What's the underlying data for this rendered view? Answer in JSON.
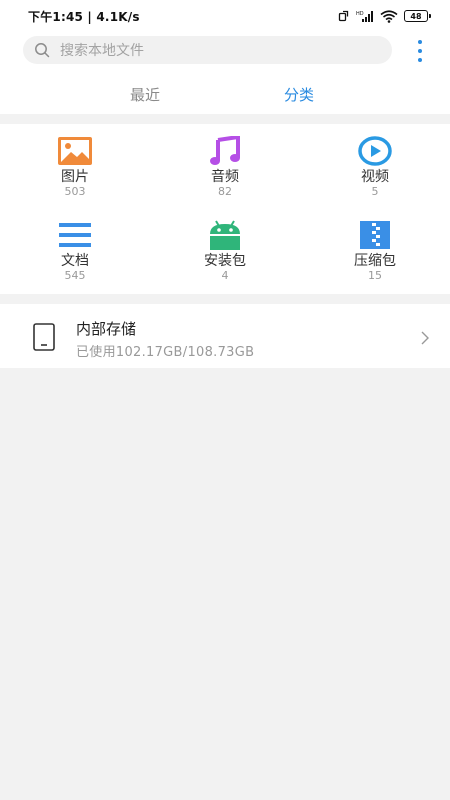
{
  "status_bar": {
    "time_speed": "下午1:45 | 4.1K/s",
    "battery": "48"
  },
  "search": {
    "placeholder": "搜索本地文件"
  },
  "tabs": [
    {
      "label": "最近",
      "active": false
    },
    {
      "label": "分类",
      "active": true
    }
  ],
  "categories": [
    {
      "label": "图片",
      "count": "503",
      "icon": "image-icon",
      "color": "#f08a3a"
    },
    {
      "label": "音频",
      "count": "82",
      "icon": "music-note-icon",
      "color": "#b54fe6"
    },
    {
      "label": "视频",
      "count": "5",
      "icon": "play-circle-icon",
      "color": "#2a9ae3"
    },
    {
      "label": "文档",
      "count": "545",
      "icon": "document-lines-icon",
      "color": "#3a8fe6"
    },
    {
      "label": "安装包",
      "count": "4",
      "icon": "android-icon",
      "color": "#2fb57a"
    },
    {
      "label": "压缩包",
      "count": "15",
      "icon": "zip-archive-icon",
      "color": "#3a8fe6"
    }
  ],
  "storage": {
    "title": "内部存储",
    "usage": "已使用102.17GB/108.73GB"
  },
  "colors": {
    "accent": "#2a8be0",
    "inactive_tab": "#8a8a8a",
    "background": "#f2f2f2"
  }
}
